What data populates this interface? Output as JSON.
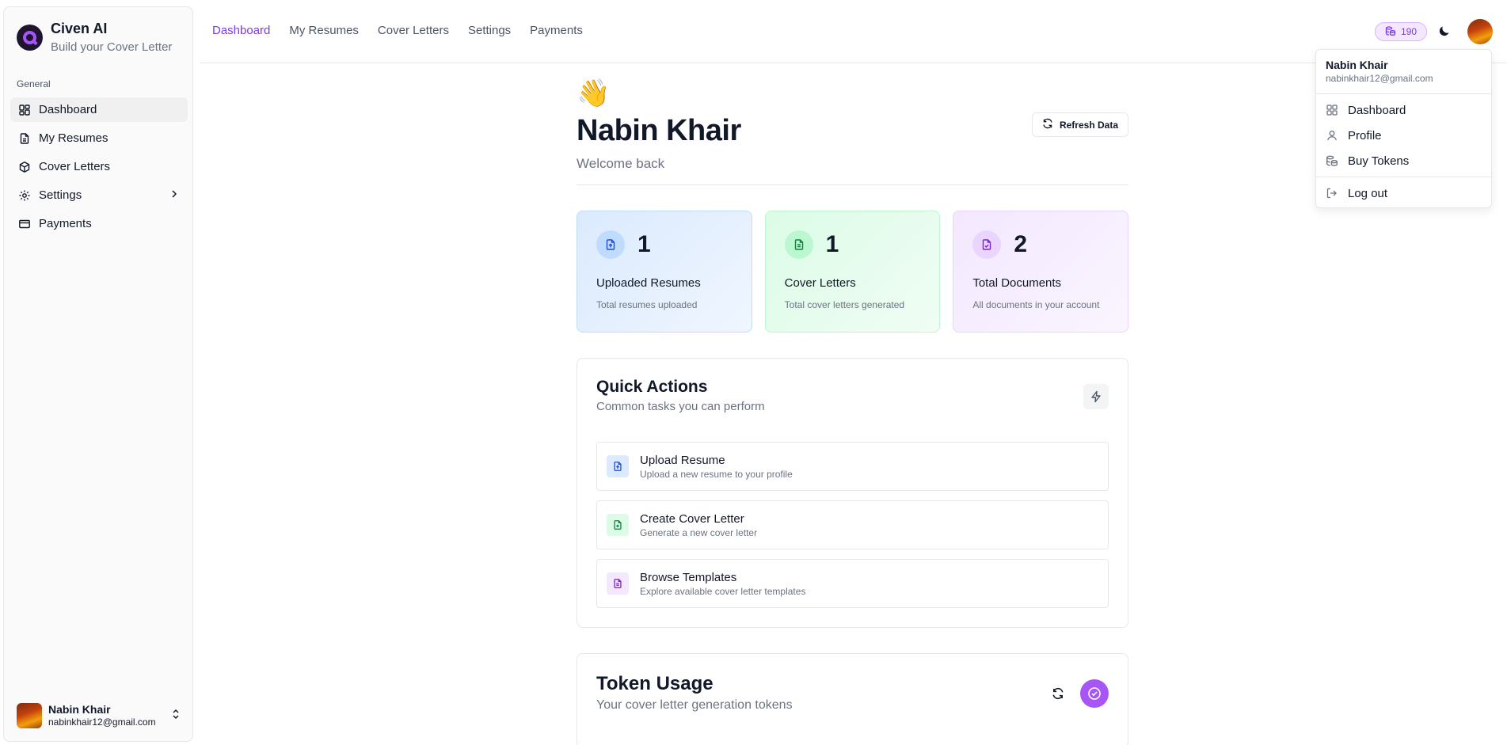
{
  "brand": {
    "title": "Civen AI",
    "subtitle": "Build your Cover Letter"
  },
  "sidebar": {
    "group_label": "General",
    "items": [
      {
        "label": "Dashboard",
        "icon": "dashboard-icon"
      },
      {
        "label": "My Resumes",
        "icon": "file-text-icon"
      },
      {
        "label": "Cover Letters",
        "icon": "package-icon"
      },
      {
        "label": "Settings",
        "icon": "gear-icon"
      },
      {
        "label": "Payments",
        "icon": "credit-card-icon"
      }
    ],
    "user": {
      "name": "Nabin Khair",
      "email": "nabinkhair12@gmail.com"
    }
  },
  "topnav": {
    "links": [
      "Dashboard",
      "My Resumes",
      "Cover Letters",
      "Settings",
      "Payments"
    ],
    "tokens": "190"
  },
  "main": {
    "wave": "👋",
    "title": "Nabin Khair",
    "welcome": "Welcome back",
    "refresh_label": "Refresh Data",
    "stats": [
      {
        "value": "1",
        "label": "Uploaded Resumes",
        "sub": "Total resumes uploaded"
      },
      {
        "value": "1",
        "label": "Cover Letters",
        "sub": "Total cover letters generated"
      },
      {
        "value": "2",
        "label": "Total Documents",
        "sub": "All documents in your account"
      }
    ],
    "quick_actions": {
      "title": "Quick Actions",
      "subtitle": "Common tasks you can perform",
      "items": [
        {
          "title": "Upload Resume",
          "sub": "Upload a new resume to your profile"
        },
        {
          "title": "Create Cover Letter",
          "sub": "Generate a new cover letter"
        },
        {
          "title": "Browse Templates",
          "sub": "Explore available cover letter templates"
        }
      ]
    },
    "token_usage": {
      "title": "Token Usage",
      "subtitle": "Your cover letter generation tokens"
    }
  },
  "dropdown": {
    "name": "Nabin Khair",
    "email": "nabinkhair12@gmail.com",
    "items": [
      "Dashboard",
      "Profile",
      "Buy Tokens"
    ],
    "logout": "Log out"
  },
  "colors": {
    "accent": "#7c3aed",
    "accent_light": "#a855f7"
  }
}
